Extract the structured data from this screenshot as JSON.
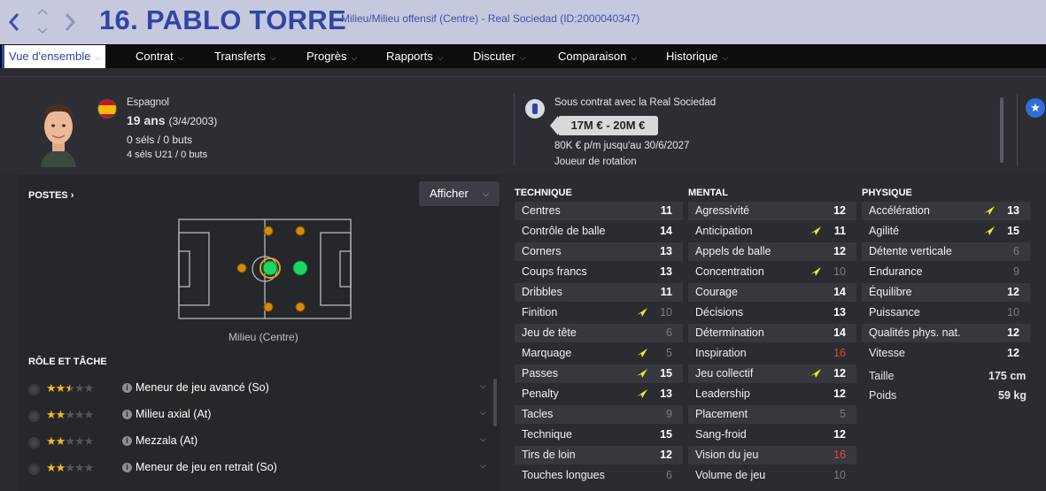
{
  "header": {
    "nav_back": "‹",
    "player_title": "16. PABLO TORRE",
    "subtitle": "Milieu/Milieu offensif (Centre) - Real Sociedad (ID:2000040347)"
  },
  "tabs": [
    {
      "label": "Vue d'ensemble"
    },
    {
      "label": "Contrat"
    },
    {
      "label": "Transferts"
    },
    {
      "label": "Progrès"
    },
    {
      "label": "Rapports"
    },
    {
      "label": "Discuter"
    },
    {
      "label": "Comparaison"
    },
    {
      "label": "Historique"
    }
  ],
  "profile": {
    "nationality": "Espagnol",
    "age_main": "19 ans",
    "age_dob": "(3/4/2003)",
    "caps": "0 séls / 0 buts",
    "u21_caps": "4 séls U21 / 0 buts",
    "contract_club": "Sous contrat avec la Real Sociedad",
    "value": "17M € - 20M €",
    "wage": "80K € p/m jusqu'au 30/6/2027",
    "status": "Joueur de rotation"
  },
  "positions": {
    "title": "POSTES",
    "show_button": "Afficher",
    "position_label": "Milieu (Centre)"
  },
  "roles": {
    "title": "RÔLE ET TÂCHE",
    "items": [
      {
        "label": "Meneur de jeu avancé (So)",
        "stars": 2.5
      },
      {
        "label": "Milieu axial (At)",
        "stars": 2
      },
      {
        "label": "Mezzala (At)",
        "stars": 2
      },
      {
        "label": "Meneur de jeu en retrait (So)",
        "stars": 2
      }
    ]
  },
  "technique": {
    "title": "TECHNIQUE",
    "items": [
      {
        "label": "Centres",
        "value": "11",
        "style": "bold",
        "arrow": false
      },
      {
        "label": "Contrôle de balle",
        "value": "14",
        "style": "bold",
        "arrow": false
      },
      {
        "label": "Corners",
        "value": "13",
        "style": "bold",
        "arrow": false
      },
      {
        "label": "Coups francs",
        "value": "13",
        "style": "bold",
        "arrow": false
      },
      {
        "label": "Dribbles",
        "value": "11",
        "style": "bold",
        "arrow": false
      },
      {
        "label": "Finition",
        "value": "10",
        "style": "dim",
        "arrow": true
      },
      {
        "label": "Jeu de tête",
        "value": "6",
        "style": "dim",
        "arrow": false
      },
      {
        "label": "Marquage",
        "value": "5",
        "style": "dim",
        "arrow": true
      },
      {
        "label": "Passes",
        "value": "15",
        "style": "bold",
        "arrow": true
      },
      {
        "label": "Penalty",
        "value": "13",
        "style": "bold",
        "arrow": true
      },
      {
        "label": "Tacles",
        "value": "9",
        "style": "dim",
        "arrow": false
      },
      {
        "label": "Technique",
        "value": "15",
        "style": "bold",
        "arrow": false
      },
      {
        "label": "Tirs de loin",
        "value": "12",
        "style": "bold",
        "arrow": false
      },
      {
        "label": "Touches longues",
        "value": "6",
        "style": "dim",
        "arrow": false
      }
    ]
  },
  "mental": {
    "title": "MENTAL",
    "items": [
      {
        "label": "Agressivité",
        "value": "12",
        "style": "bold",
        "arrow": false
      },
      {
        "label": "Anticipation",
        "value": "11",
        "style": "bold",
        "arrow": true
      },
      {
        "label": "Appels de balle",
        "value": "12",
        "style": "bold",
        "arrow": false
      },
      {
        "label": "Concentration",
        "value": "10",
        "style": "dim",
        "arrow": true
      },
      {
        "label": "Courage",
        "value": "14",
        "style": "bold",
        "arrow": false
      },
      {
        "label": "Décisions",
        "value": "13",
        "style": "bold",
        "arrow": false
      },
      {
        "label": "Détermination",
        "value": "14",
        "style": "bold",
        "arrow": false
      },
      {
        "label": "Inspiration",
        "value": "16",
        "style": "red",
        "arrow": false
      },
      {
        "label": "Jeu collectif",
        "value": "12",
        "style": "bold",
        "arrow": true
      },
      {
        "label": "Leadership",
        "value": "12",
        "style": "bold",
        "arrow": false
      },
      {
        "label": "Placement",
        "value": "5",
        "style": "dim",
        "arrow": false
      },
      {
        "label": "Sang-froid",
        "value": "12",
        "style": "bold",
        "arrow": false
      },
      {
        "label": "Vision du jeu",
        "value": "16",
        "style": "red",
        "arrow": false
      },
      {
        "label": "Volume de jeu",
        "value": "10",
        "style": "dim",
        "arrow": false
      }
    ]
  },
  "physique": {
    "title": "PHYSIQUE",
    "items": [
      {
        "label": "Accélération",
        "value": "13",
        "style": "bold",
        "arrow": true
      },
      {
        "label": "Agilité",
        "value": "15",
        "style": "bold",
        "arrow": true
      },
      {
        "label": "Détente verticale",
        "value": "6",
        "style": "dim",
        "arrow": false
      },
      {
        "label": "Endurance",
        "value": "9",
        "style": "dim",
        "arrow": false
      },
      {
        "label": "Équilibre",
        "value": "12",
        "style": "bold",
        "arrow": false
      },
      {
        "label": "Puissance",
        "value": "10",
        "style": "dim",
        "arrow": false
      },
      {
        "label": "Qualités phys. nat.",
        "value": "12",
        "style": "bold",
        "arrow": false
      },
      {
        "label": "Vitesse",
        "value": "12",
        "style": "bold",
        "arrow": false
      }
    ],
    "height_label": "Taille",
    "height_value": "175 cm",
    "weight_label": "Poids",
    "weight_value": "59 kg"
  },
  "colors": {
    "accent": "#2f45a8",
    "arrow_up": "#e7f02a",
    "highlight_red": "#e8443a",
    "star": "#f5b91e",
    "natural_position": "#1ed760",
    "secondary_position": "#d68a0c"
  }
}
